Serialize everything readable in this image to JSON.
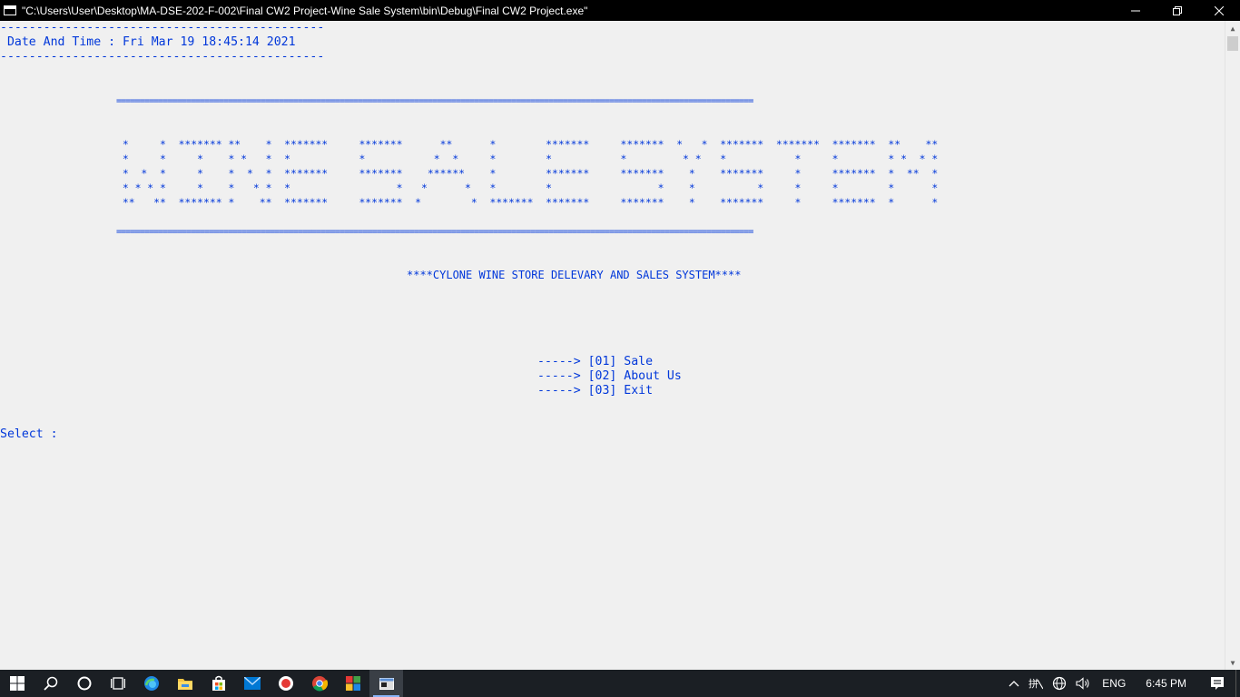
{
  "window": {
    "title": "\"C:\\Users\\User\\Desktop\\MA-DSE-202-F-002\\Final CW2 Project-Wine Sale System\\bin\\Debug\\Final CW2 Project.exe\"",
    "minimize_icon": "minimize-icon",
    "maximize_icon": "restore-icon",
    "close_icon": "close-icon"
  },
  "console": {
    "dash_top": "---------------------------------------------",
    "datetime": " Date And Time : Fri Mar 19 18:45:14 2021",
    "dash_bottom": "---------------------------------------------",
    "rule_top": "=========================================================================================================================================",
    "banner": [
      " *     *  ******* **    *  *******     *******      **      *        *******     *******  *   *  *******  *******  *******  **    **",
      " *     *     *    * *   *  *           *           *  *     *        *           *         * *   *           *     *        * *  * *",
      " *  *  *     *    *  *  *  *******     *******    ******    *        *******     *******    *    *******     *     *******  *  **  *",
      " * * * *     *    *   * *  *                 *   *      *   *        *                 *    *          *     *     *        *      *",
      " **   **  ******* *    **  *******     *******  *        *  *******  *******     *******    *    *******     *     *******  *      *"
    ],
    "rule_bottom": "=========================================================================================================================================",
    "subtitle": "****CYLONE WINE STORE DELEVARY AND SALES SYSTEM****",
    "menu": [
      "-----> [01] Sale",
      "-----> [02] About Us",
      "-----> [03] Exit"
    ],
    "prompt": "Select :"
  },
  "taskbar": {
    "apps": [
      "start-icon",
      "search-icon",
      "cortana-icon",
      "task-view-icon",
      "edge-icon",
      "file-explorer-icon",
      "store-icon",
      "mail-icon",
      "record-icon",
      "chrome-icon",
      "app-icon",
      "console-icon"
    ],
    "language": "ENG",
    "time": "6:45 PM"
  },
  "colors": {
    "console_text": "#0037da",
    "console_bg": "#f0f0f0",
    "titlebar_bg": "#000000",
    "taskbar_bg": "#1b1f24"
  }
}
